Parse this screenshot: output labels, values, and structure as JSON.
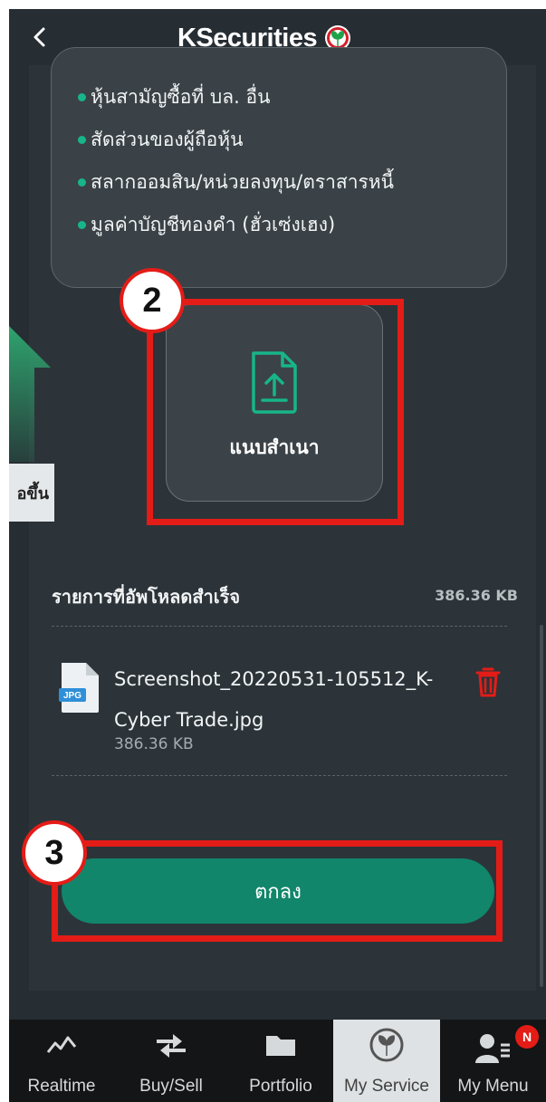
{
  "header": {
    "brand": "KSecurities",
    "back_icon": "chevron-left-icon"
  },
  "info_list": [
    "หุ้นสามัญซื้อที่ บล. อื่น",
    "สัดส่วนของผู้ถือหุ้น",
    "สลากออมสิน/หน่วยลงทุน/ตราสารหนี้",
    "มูลค่าบัญชีทองคำ (ฮั่วเซ่งเฮง)"
  ],
  "upload": {
    "label": "แนบสำเนา",
    "icon": "upload-file-icon"
  },
  "annotations": {
    "step2": "2",
    "step3": "3",
    "swipe_hint": "อขึ้น"
  },
  "uploaded": {
    "title": "รายการที่อัพโหลดสำเร็จ",
    "total_size": "386.36 KB",
    "files": [
      {
        "name_line1": "Screenshot_20220531-105512_K-",
        "name_line2": "Cyber Trade.jpg",
        "size": "386.36 KB",
        "type": "JPG"
      }
    ]
  },
  "confirm_button": "ตกลง",
  "bottom_nav": [
    {
      "label": "Realtime",
      "icon": "chart-line-icon"
    },
    {
      "label": "Buy/Sell",
      "icon": "swap-arrows-icon"
    },
    {
      "label": "Portfolio",
      "icon": "folder-icon"
    },
    {
      "label": "My Service",
      "icon": "kbank-leaf-icon",
      "active": true
    },
    {
      "label": "My Menu",
      "icon": "user-menu-icon",
      "badge": "N"
    }
  ],
  "colors": {
    "accent": "#11866b",
    "highlight": "#e41c17",
    "background": "#262d33"
  }
}
